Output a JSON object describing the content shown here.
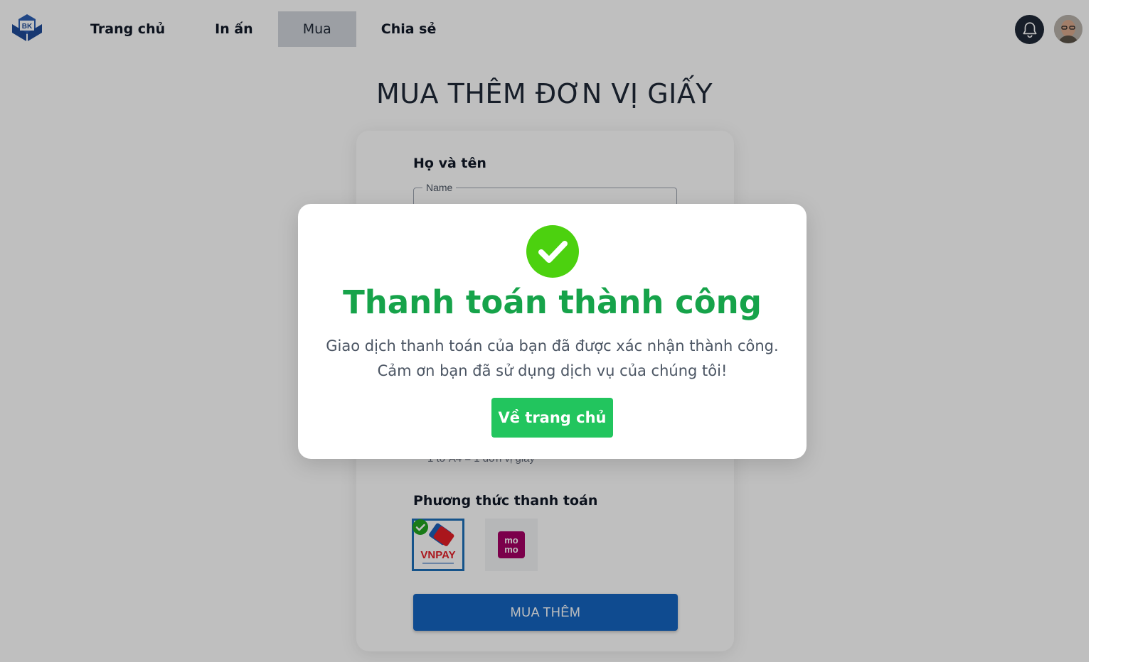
{
  "header": {
    "logo_text": "BK",
    "nav": [
      "Trang chủ",
      "In ấn",
      "Mua",
      "Chia sẻ"
    ],
    "active_nav": "Mua"
  },
  "page": {
    "title": "MUA THÊM ĐƠN VỊ GIẤY"
  },
  "form": {
    "name_label": "Họ và tên",
    "name_placeholder": "Name",
    "conversion_hint": "1 tờ A4 = 1 đơn vị giấy",
    "payment_label": "Phương thức thanh toán",
    "payment_methods": [
      "VNPAY",
      "momo"
    ],
    "selected_payment": "VNPAY",
    "submit_label": "MUA THÊM"
  },
  "modal": {
    "title": "Thanh toán thành công",
    "message_line1": "Giao dịch thanh toán của bạn đã được xác nhận thành công.",
    "message_line2": "Cảm ơn bạn đã sử dụng dịch vụ của chúng tôi!",
    "button_label": "Về trang chủ"
  },
  "colors": {
    "success": "#16a34a",
    "success_button": "#22c55e",
    "primary": "#1565c0",
    "momo": "#a50064"
  }
}
